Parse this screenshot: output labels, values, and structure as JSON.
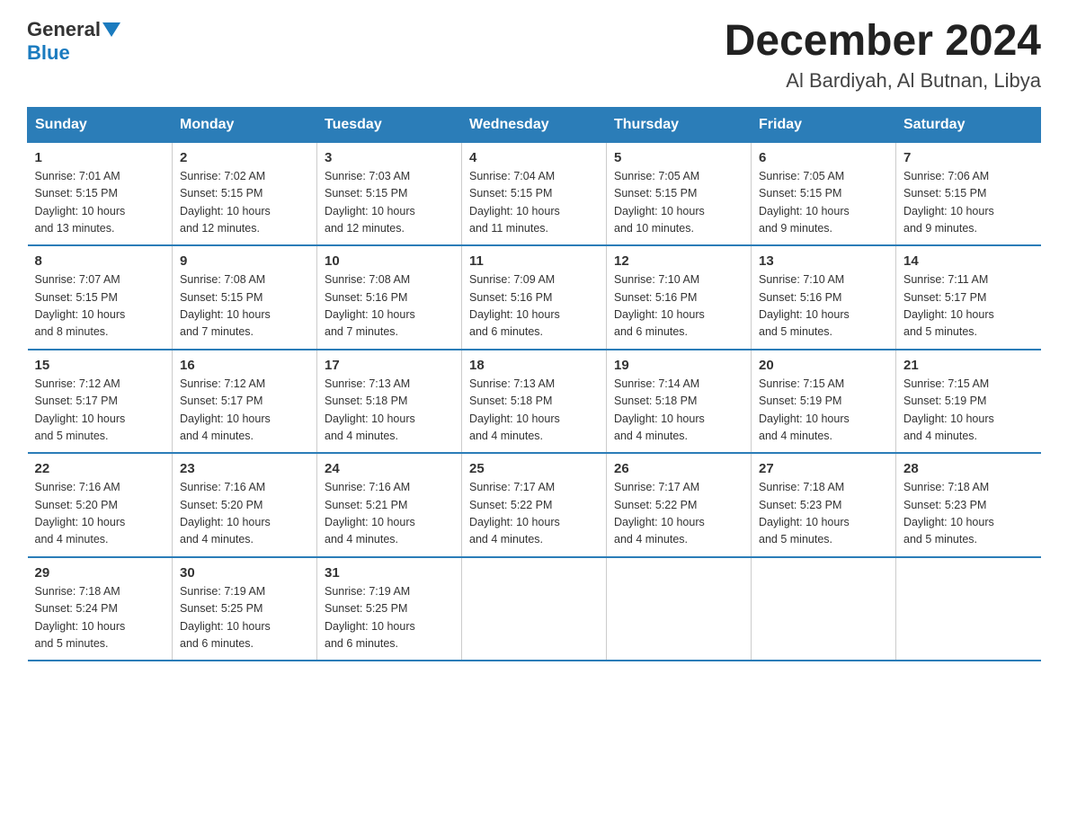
{
  "header": {
    "logo_general": "General",
    "logo_blue": "Blue",
    "title": "December 2024",
    "subtitle": "Al Bardiyah, Al Butnan, Libya"
  },
  "weekdays": [
    "Sunday",
    "Monday",
    "Tuesday",
    "Wednesday",
    "Thursday",
    "Friday",
    "Saturday"
  ],
  "weeks": [
    [
      {
        "day": "1",
        "info": "Sunrise: 7:01 AM\nSunset: 5:15 PM\nDaylight: 10 hours\nand 13 minutes."
      },
      {
        "day": "2",
        "info": "Sunrise: 7:02 AM\nSunset: 5:15 PM\nDaylight: 10 hours\nand 12 minutes."
      },
      {
        "day": "3",
        "info": "Sunrise: 7:03 AM\nSunset: 5:15 PM\nDaylight: 10 hours\nand 12 minutes."
      },
      {
        "day": "4",
        "info": "Sunrise: 7:04 AM\nSunset: 5:15 PM\nDaylight: 10 hours\nand 11 minutes."
      },
      {
        "day": "5",
        "info": "Sunrise: 7:05 AM\nSunset: 5:15 PM\nDaylight: 10 hours\nand 10 minutes."
      },
      {
        "day": "6",
        "info": "Sunrise: 7:05 AM\nSunset: 5:15 PM\nDaylight: 10 hours\nand 9 minutes."
      },
      {
        "day": "7",
        "info": "Sunrise: 7:06 AM\nSunset: 5:15 PM\nDaylight: 10 hours\nand 9 minutes."
      }
    ],
    [
      {
        "day": "8",
        "info": "Sunrise: 7:07 AM\nSunset: 5:15 PM\nDaylight: 10 hours\nand 8 minutes."
      },
      {
        "day": "9",
        "info": "Sunrise: 7:08 AM\nSunset: 5:15 PM\nDaylight: 10 hours\nand 7 minutes."
      },
      {
        "day": "10",
        "info": "Sunrise: 7:08 AM\nSunset: 5:16 PM\nDaylight: 10 hours\nand 7 minutes."
      },
      {
        "day": "11",
        "info": "Sunrise: 7:09 AM\nSunset: 5:16 PM\nDaylight: 10 hours\nand 6 minutes."
      },
      {
        "day": "12",
        "info": "Sunrise: 7:10 AM\nSunset: 5:16 PM\nDaylight: 10 hours\nand 6 minutes."
      },
      {
        "day": "13",
        "info": "Sunrise: 7:10 AM\nSunset: 5:16 PM\nDaylight: 10 hours\nand 5 minutes."
      },
      {
        "day": "14",
        "info": "Sunrise: 7:11 AM\nSunset: 5:17 PM\nDaylight: 10 hours\nand 5 minutes."
      }
    ],
    [
      {
        "day": "15",
        "info": "Sunrise: 7:12 AM\nSunset: 5:17 PM\nDaylight: 10 hours\nand 5 minutes."
      },
      {
        "day": "16",
        "info": "Sunrise: 7:12 AM\nSunset: 5:17 PM\nDaylight: 10 hours\nand 4 minutes."
      },
      {
        "day": "17",
        "info": "Sunrise: 7:13 AM\nSunset: 5:18 PM\nDaylight: 10 hours\nand 4 minutes."
      },
      {
        "day": "18",
        "info": "Sunrise: 7:13 AM\nSunset: 5:18 PM\nDaylight: 10 hours\nand 4 minutes."
      },
      {
        "day": "19",
        "info": "Sunrise: 7:14 AM\nSunset: 5:18 PM\nDaylight: 10 hours\nand 4 minutes."
      },
      {
        "day": "20",
        "info": "Sunrise: 7:15 AM\nSunset: 5:19 PM\nDaylight: 10 hours\nand 4 minutes."
      },
      {
        "day": "21",
        "info": "Sunrise: 7:15 AM\nSunset: 5:19 PM\nDaylight: 10 hours\nand 4 minutes."
      }
    ],
    [
      {
        "day": "22",
        "info": "Sunrise: 7:16 AM\nSunset: 5:20 PM\nDaylight: 10 hours\nand 4 minutes."
      },
      {
        "day": "23",
        "info": "Sunrise: 7:16 AM\nSunset: 5:20 PM\nDaylight: 10 hours\nand 4 minutes."
      },
      {
        "day": "24",
        "info": "Sunrise: 7:16 AM\nSunset: 5:21 PM\nDaylight: 10 hours\nand 4 minutes."
      },
      {
        "day": "25",
        "info": "Sunrise: 7:17 AM\nSunset: 5:22 PM\nDaylight: 10 hours\nand 4 minutes."
      },
      {
        "day": "26",
        "info": "Sunrise: 7:17 AM\nSunset: 5:22 PM\nDaylight: 10 hours\nand 4 minutes."
      },
      {
        "day": "27",
        "info": "Sunrise: 7:18 AM\nSunset: 5:23 PM\nDaylight: 10 hours\nand 5 minutes."
      },
      {
        "day": "28",
        "info": "Sunrise: 7:18 AM\nSunset: 5:23 PM\nDaylight: 10 hours\nand 5 minutes."
      }
    ],
    [
      {
        "day": "29",
        "info": "Sunrise: 7:18 AM\nSunset: 5:24 PM\nDaylight: 10 hours\nand 5 minutes."
      },
      {
        "day": "30",
        "info": "Sunrise: 7:19 AM\nSunset: 5:25 PM\nDaylight: 10 hours\nand 6 minutes."
      },
      {
        "day": "31",
        "info": "Sunrise: 7:19 AM\nSunset: 5:25 PM\nDaylight: 10 hours\nand 6 minutes."
      },
      null,
      null,
      null,
      null
    ]
  ]
}
